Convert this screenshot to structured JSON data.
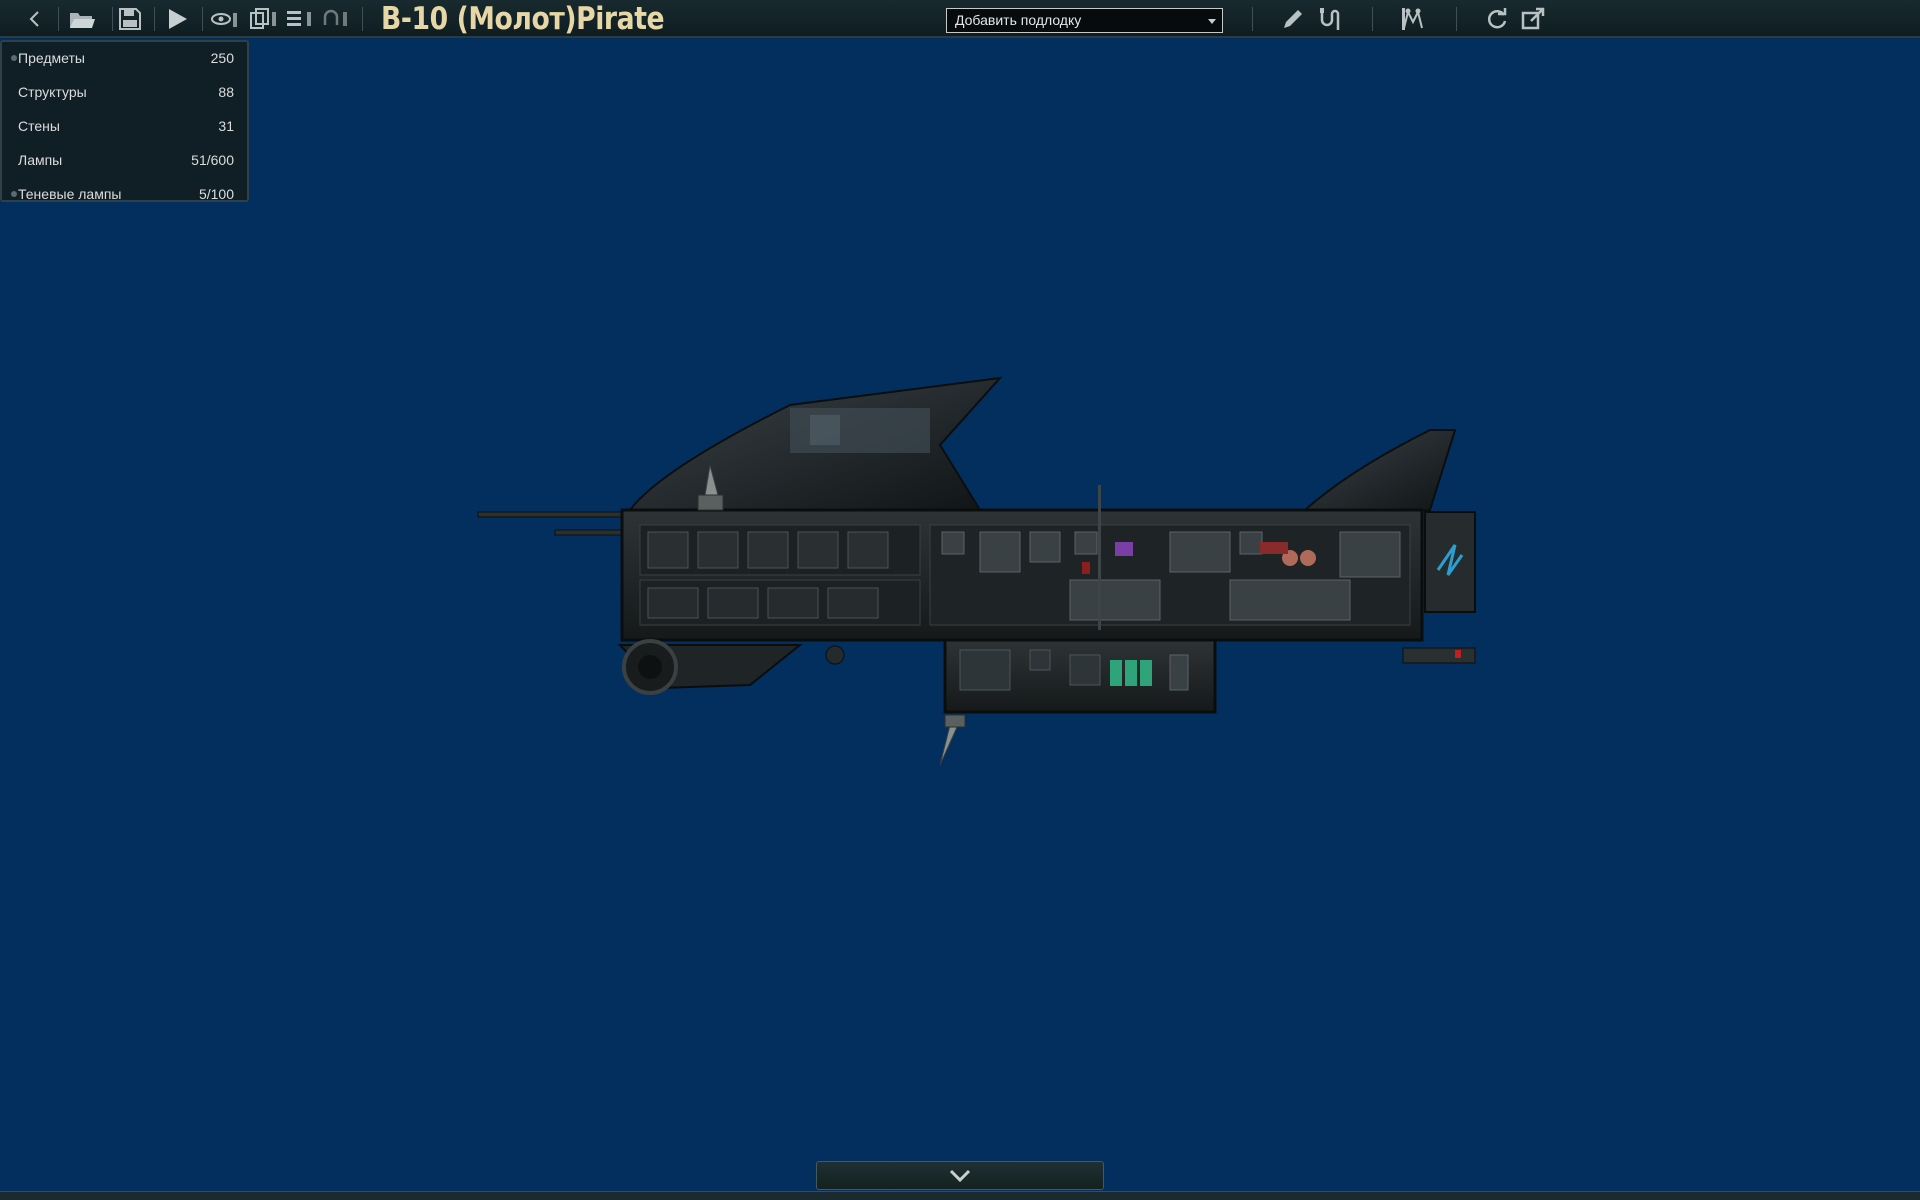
{
  "toolbar": {
    "title": "B-10 (Молот)Pirate",
    "submarine_dropdown": {
      "selected": "Добавить подлодку"
    },
    "icons": [
      "back-icon",
      "open-folder-icon",
      "save-icon",
      "play-icon",
      "visibility-icon",
      "layers-icon",
      "list-icon",
      "undo-icon",
      "pencil-icon",
      "wire-icon",
      "waypoint-icon",
      "refresh-icon",
      "export-icon"
    ]
  },
  "stats": {
    "items": [
      {
        "label": "Предметы",
        "value": "250"
      },
      {
        "label": "Структуры",
        "value": "88"
      },
      {
        "label": "Стены",
        "value": "31"
      },
      {
        "label": "Лампы",
        "value": "51/600"
      },
      {
        "label": "Теневые лампы",
        "value": "5/100"
      }
    ]
  },
  "colors": {
    "background": "#022f5e",
    "title": "#e8d7a6",
    "toolbar": "#182a2f"
  },
  "bottom": {
    "icon": "chevron-down-icon"
  }
}
